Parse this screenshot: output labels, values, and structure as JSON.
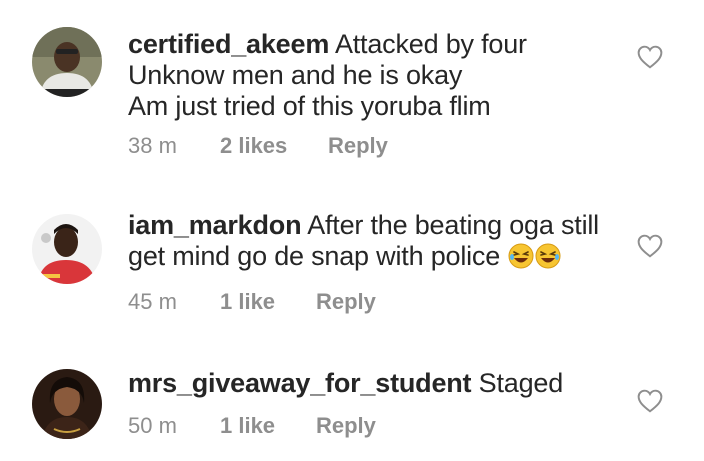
{
  "comments": [
    {
      "username": "certified_akeem",
      "lines": [
        "Attacked by four",
        "Unknow men and he is okay",
        "Am just tried of this yoruba flim"
      ],
      "time": "38 m",
      "likes": "2 likes",
      "reply": "Reply",
      "avatar_icon": "user-avatar-photo",
      "like_icon": "heart-outline-icon"
    },
    {
      "username": "iam_markdon",
      "lines": [
        "After the beating oga still",
        "get mind go de snap with police"
      ],
      "emoji": [
        "rofl-emoji",
        "rofl-emoji"
      ],
      "time": "45 m",
      "likes": "1 like",
      "reply": "Reply",
      "avatar_icon": "user-avatar-photo",
      "like_icon": "heart-outline-icon"
    },
    {
      "username": "mrs_giveaway_for_student",
      "lines": [
        "Staged"
      ],
      "time": "50 m",
      "likes": "1 like",
      "reply": "Reply",
      "avatar_icon": "user-avatar-photo",
      "like_icon": "heart-outline-icon"
    }
  ],
  "colors": {
    "text": "#262626",
    "meta": "#8e8e8e",
    "heart_outline": "#8e8e8e"
  }
}
